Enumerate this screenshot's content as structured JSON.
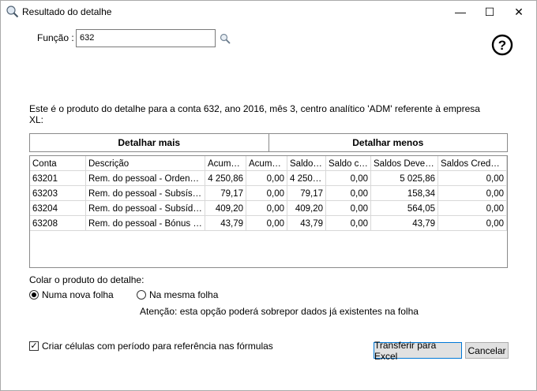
{
  "window": {
    "title": "Resultado do detalhe",
    "minimize_glyph": "—",
    "maximize_glyph": "☐",
    "close_glyph": "✕"
  },
  "function": {
    "label": "Função :",
    "value": "632"
  },
  "description": "Este é o produto do detalhe para a conta 632, ano 2016, mês 3, centro analítico 'ADM' referente à empresa XL:",
  "tabs": {
    "more": "Detalhar mais",
    "less": "Detalhar menos"
  },
  "grid": {
    "columns": [
      "Conta",
      "Descrição",
      "Acumul…",
      "Acumul…",
      "Saldo …",
      "Saldo cr…",
      "Saldos Deved…",
      "Saldos Credor…"
    ],
    "rows": [
      [
        "63201",
        "Rem. do pessoal - Ordena…",
        "4 250,86",
        "0,00",
        "4 250,86",
        "0,00",
        "5 025,86",
        "0,00"
      ],
      [
        "63203",
        "Rem. do pessoal - Subsísi…",
        "79,17",
        "0,00",
        "79,17",
        "0,00",
        "158,34",
        "0,00"
      ],
      [
        "63204",
        "Rem. do pessoal - Subsídi…",
        "409,20",
        "0,00",
        "409,20",
        "0,00",
        "564,05",
        "0,00"
      ],
      [
        "63208",
        "Rem. do pessoal - Bónus e…",
        "43,79",
        "0,00",
        "43,79",
        "0,00",
        "43,79",
        "0,00"
      ]
    ]
  },
  "paste": {
    "label": "Colar o produto do detalhe:",
    "option_new": "Numa nova folha",
    "option_same": "Na mesma folha",
    "warning": "Atenção: esta opção poderá sobrepor dados já existentes na folha"
  },
  "checkbox": {
    "label": "Criar células com período para referência nas fórmulas",
    "checked_glyph": "✓"
  },
  "buttons": {
    "transfer": "Transferir para Excel",
    "cancel": "Cancelar"
  },
  "help_glyph": "?",
  "colors": {
    "accent": "#0078d7",
    "border": "#8a8a8a"
  }
}
